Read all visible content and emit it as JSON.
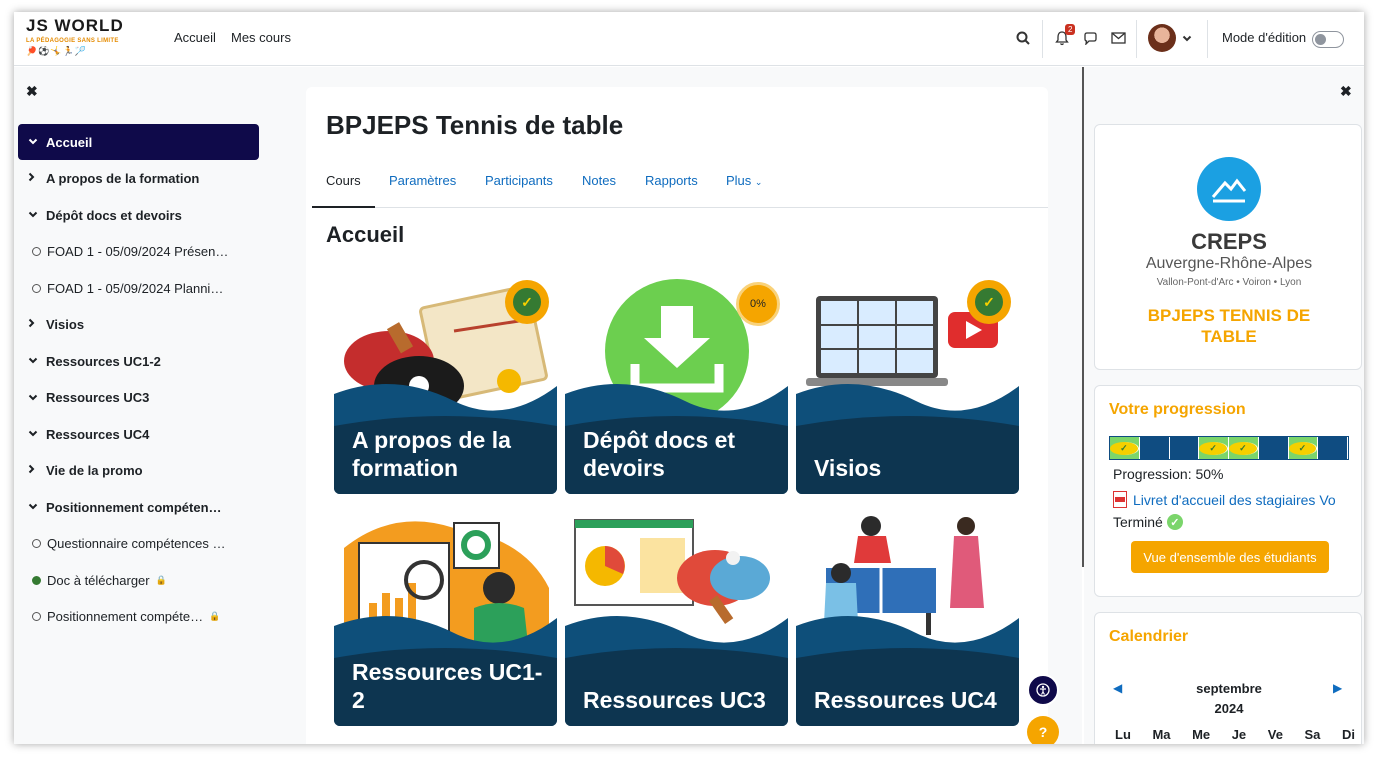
{
  "navbar": {
    "logo_line1": "JS WORLD",
    "logo_line2": "LA PÉDAGOGIE SANS LIMITE",
    "links": [
      "Accueil",
      "Mes cours"
    ],
    "notification_count": "2",
    "edit_mode_label": "Mode d'édition"
  },
  "drawer": {
    "items": [
      {
        "label": "Accueil",
        "type": "section",
        "chevron": "down",
        "active": true
      },
      {
        "label": "A propos de la formation",
        "type": "section",
        "chevron": "right"
      },
      {
        "label": "Dépôt docs et devoirs",
        "type": "section",
        "chevron": "down"
      },
      {
        "label": "FOAD 1 - 05/09/2024 Présen…",
        "type": "activity"
      },
      {
        "label": "FOAD 1 - 05/09/2024 Planni…",
        "type": "activity"
      },
      {
        "label": "Visios",
        "type": "section",
        "chevron": "right"
      },
      {
        "label": "Ressources UC1-2",
        "type": "section",
        "chevron": "down"
      },
      {
        "label": "Ressources UC3",
        "type": "section",
        "chevron": "down"
      },
      {
        "label": "Ressources UC4",
        "type": "section",
        "chevron": "down"
      },
      {
        "label": "Vie de la promo",
        "type": "section",
        "chevron": "right"
      },
      {
        "label": "Positionnement compéten…",
        "type": "section",
        "chevron": "down"
      },
      {
        "label": "Questionnaire compétences …",
        "type": "activity"
      },
      {
        "label": "Doc à télécharger",
        "type": "activity",
        "done": true,
        "locked": true
      },
      {
        "label": "Positionnement compéte…",
        "type": "activity",
        "locked": true
      }
    ]
  },
  "course": {
    "title": "BPJEPS Tennis de table",
    "tabs": [
      "Cours",
      "Paramètres",
      "Participants",
      "Notes",
      "Rapports",
      "Plus"
    ],
    "section_title": "Accueil",
    "tiles": [
      {
        "title": "A propos de la formation",
        "status": "complete"
      },
      {
        "title": "Dépôt docs et devoirs",
        "status": "0%"
      },
      {
        "title": "Visios",
        "status": "complete"
      },
      {
        "title": "Ressources UC1-2",
        "status": ""
      },
      {
        "title": "Ressources UC3",
        "status": ""
      },
      {
        "title": "Ressources UC4",
        "status": ""
      }
    ]
  },
  "right": {
    "creps_name": "CREPS",
    "creps_region": "Auvergne-Rhône-Alpes",
    "creps_sites": "Vallon-Pont-d'Arc • Voiron • Lyon",
    "creps_course": "BPJEPS TENNIS DE TABLE",
    "progress_title": "Votre progression",
    "progress_segments": [
      1,
      0,
      0,
      1,
      1,
      0,
      1,
      0
    ],
    "progress_text": "Progression: 50%",
    "progress_link": "Livret d'accueil des stagiaires Vo",
    "progress_status": "Terminé",
    "overview_button": "Vue d'ensemble des étudiants",
    "calendar_title": "Calendrier",
    "calendar_month": "septembre",
    "calendar_year": "2024",
    "calendar_days": [
      "Lu",
      "Ma",
      "Me",
      "Je",
      "Ve",
      "Sa",
      "Di"
    ]
  },
  "colors": {
    "accent": "#f5a500",
    "link": "#0f6cbf",
    "active_nav": "#0f0a4a",
    "tile_dark": "#0e3a5c"
  }
}
